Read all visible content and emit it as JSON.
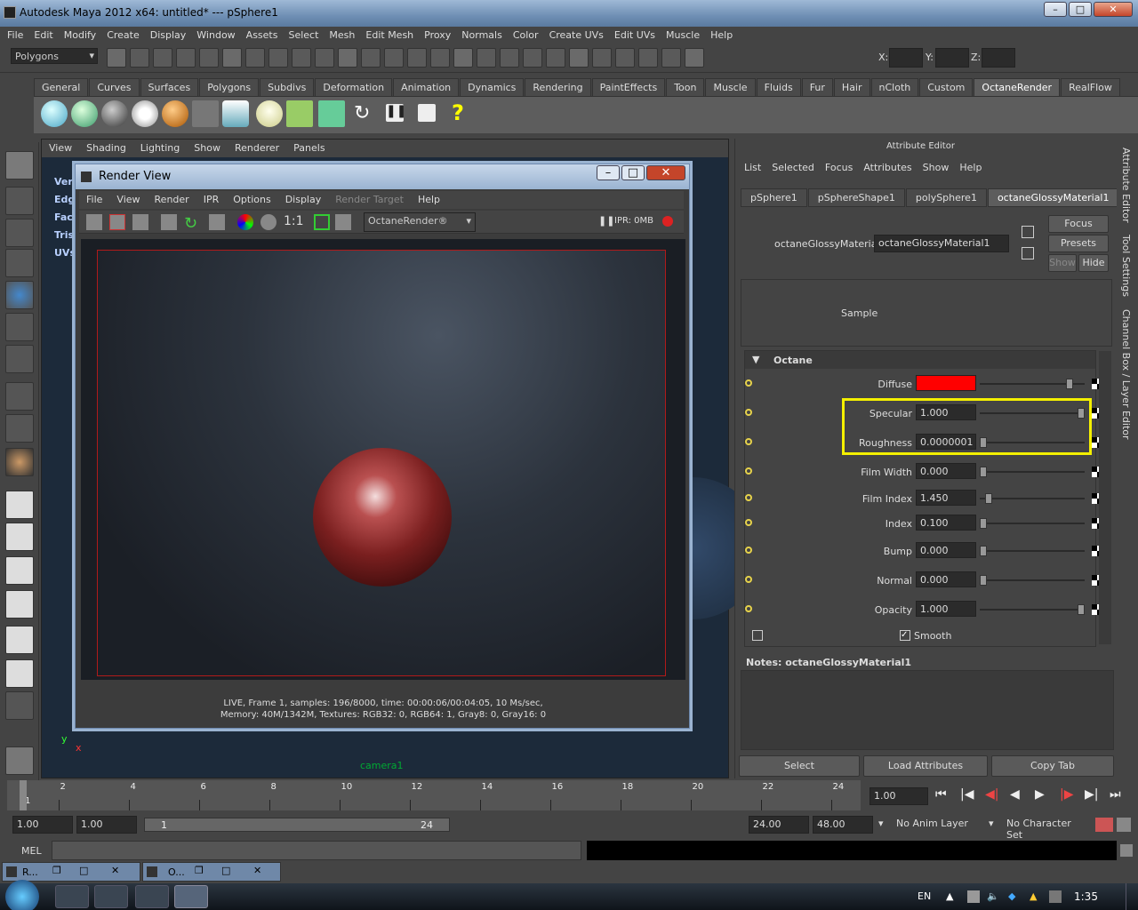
{
  "window": {
    "title": "Autodesk Maya 2012 x64: untitled*   ---   pSphere1"
  },
  "menu": [
    "File",
    "Edit",
    "Modify",
    "Create",
    "Display",
    "Window",
    "Assets",
    "Select",
    "Mesh",
    "Edit Mesh",
    "Proxy",
    "Normals",
    "Color",
    "Create UVs",
    "Edit UVs",
    "Muscle",
    "Help"
  ],
  "statusline": {
    "mode": "Polygons",
    "x_label": "X:",
    "y_label": "Y:",
    "z_label": "Z:"
  },
  "shelf_tabs": [
    "General",
    "Curves",
    "Surfaces",
    "Polygons",
    "Subdivs",
    "Deformation",
    "Animation",
    "Dynamics",
    "Rendering",
    "PaintEffects",
    "Toon",
    "Muscle",
    "Fluids",
    "Fur",
    "Hair",
    "nCloth",
    "Custom",
    "OctaneRender",
    "RealFlow"
  ],
  "shelf_active": "OctaneRender",
  "viewport": {
    "menu": [
      "View",
      "Shading",
      "Lighting",
      "Show",
      "Renderer",
      "Panels"
    ],
    "hud_left": [
      "Verts:",
      "Edges:",
      "Faces:",
      "Tris:",
      "UVs:"
    ],
    "camera": "camera1",
    "axis_y": "y",
    "axis_x": "x"
  },
  "render_view": {
    "title": "Render View",
    "menu": [
      "File",
      "View",
      "Render",
      "IPR",
      "Options",
      "Display",
      "Render Target",
      "Help"
    ],
    "ratio": "1:1",
    "renderer": "OctaneRender®",
    "ipr": "IPR: 0MB",
    "status_line1": "LIVE, Frame 1, samples: 196/8000, time: 00:00:06/00:04:05, 10 Ms/sec,",
    "status_line2": "Memory: 40M/1342M, Textures: RGB32: 0, RGB64: 1, Gray8: 0, Gray16: 0"
  },
  "attribute_editor": {
    "title": "Attribute Editor",
    "menu": [
      "List",
      "Selected",
      "Focus",
      "Attributes",
      "Show",
      "Help"
    ],
    "tabs": [
      "pSphere1",
      "pSphereShape1",
      "polySphere1",
      "octaneGlossyMaterial1"
    ],
    "active_tab": "octaneGlossyMaterial1",
    "material_label": "octaneGlossyMaterial:",
    "material_name": "octaneGlossyMaterial1",
    "focus": "Focus",
    "presets": "Presets",
    "show": "Show",
    "hide": "Hide",
    "sample": "Sample",
    "section": "Octane",
    "attrs": [
      {
        "label": "Diffuse",
        "value": "",
        "level": 0.88
      },
      {
        "label": "Specular",
        "value": "1.000",
        "level": 1.0
      },
      {
        "label": "Roughness",
        "value": "0.0000001",
        "level": 0.0
      },
      {
        "label": "Film Width",
        "value": "0.000",
        "level": 0.0
      },
      {
        "label": "Film Index",
        "value": "1.450",
        "level": 0.05
      },
      {
        "label": "Index",
        "value": "0.100",
        "level": 0.0
      },
      {
        "label": "Bump",
        "value": "0.000",
        "level": 0.0
      },
      {
        "label": "Normal",
        "value": "0.000",
        "level": 0.0
      },
      {
        "label": "Opacity",
        "value": "1.000",
        "level": 1.0
      }
    ],
    "smooth": "Smooth",
    "notes_label": "Notes:  octaneGlossyMaterial1",
    "bottom": [
      "Select",
      "Load Attributes",
      "Copy Tab"
    ],
    "diffuse_color": "#ff0000"
  },
  "side_tabs": [
    "Attribute Editor",
    "Tool Settings",
    "Channel Box / Layer Editor"
  ],
  "timeline": {
    "ticks": [
      "1",
      "2",
      "4",
      "6",
      "8",
      "10",
      "12",
      "14",
      "16",
      "18",
      "20",
      "22",
      "24"
    ],
    "current": "1.00"
  },
  "range": {
    "start": "1.00",
    "start2": "1.00",
    "slider_start": "1",
    "slider_end": "24",
    "end": "24.00",
    "end2": "48.00",
    "anim_layer": "No Anim Layer",
    "char_set": "No Character Set"
  },
  "cmd": {
    "label": "MEL"
  },
  "mini_windows": [
    "R...",
    "O..."
  ],
  "taskbar": {
    "lang": "EN",
    "time": "1:35"
  }
}
